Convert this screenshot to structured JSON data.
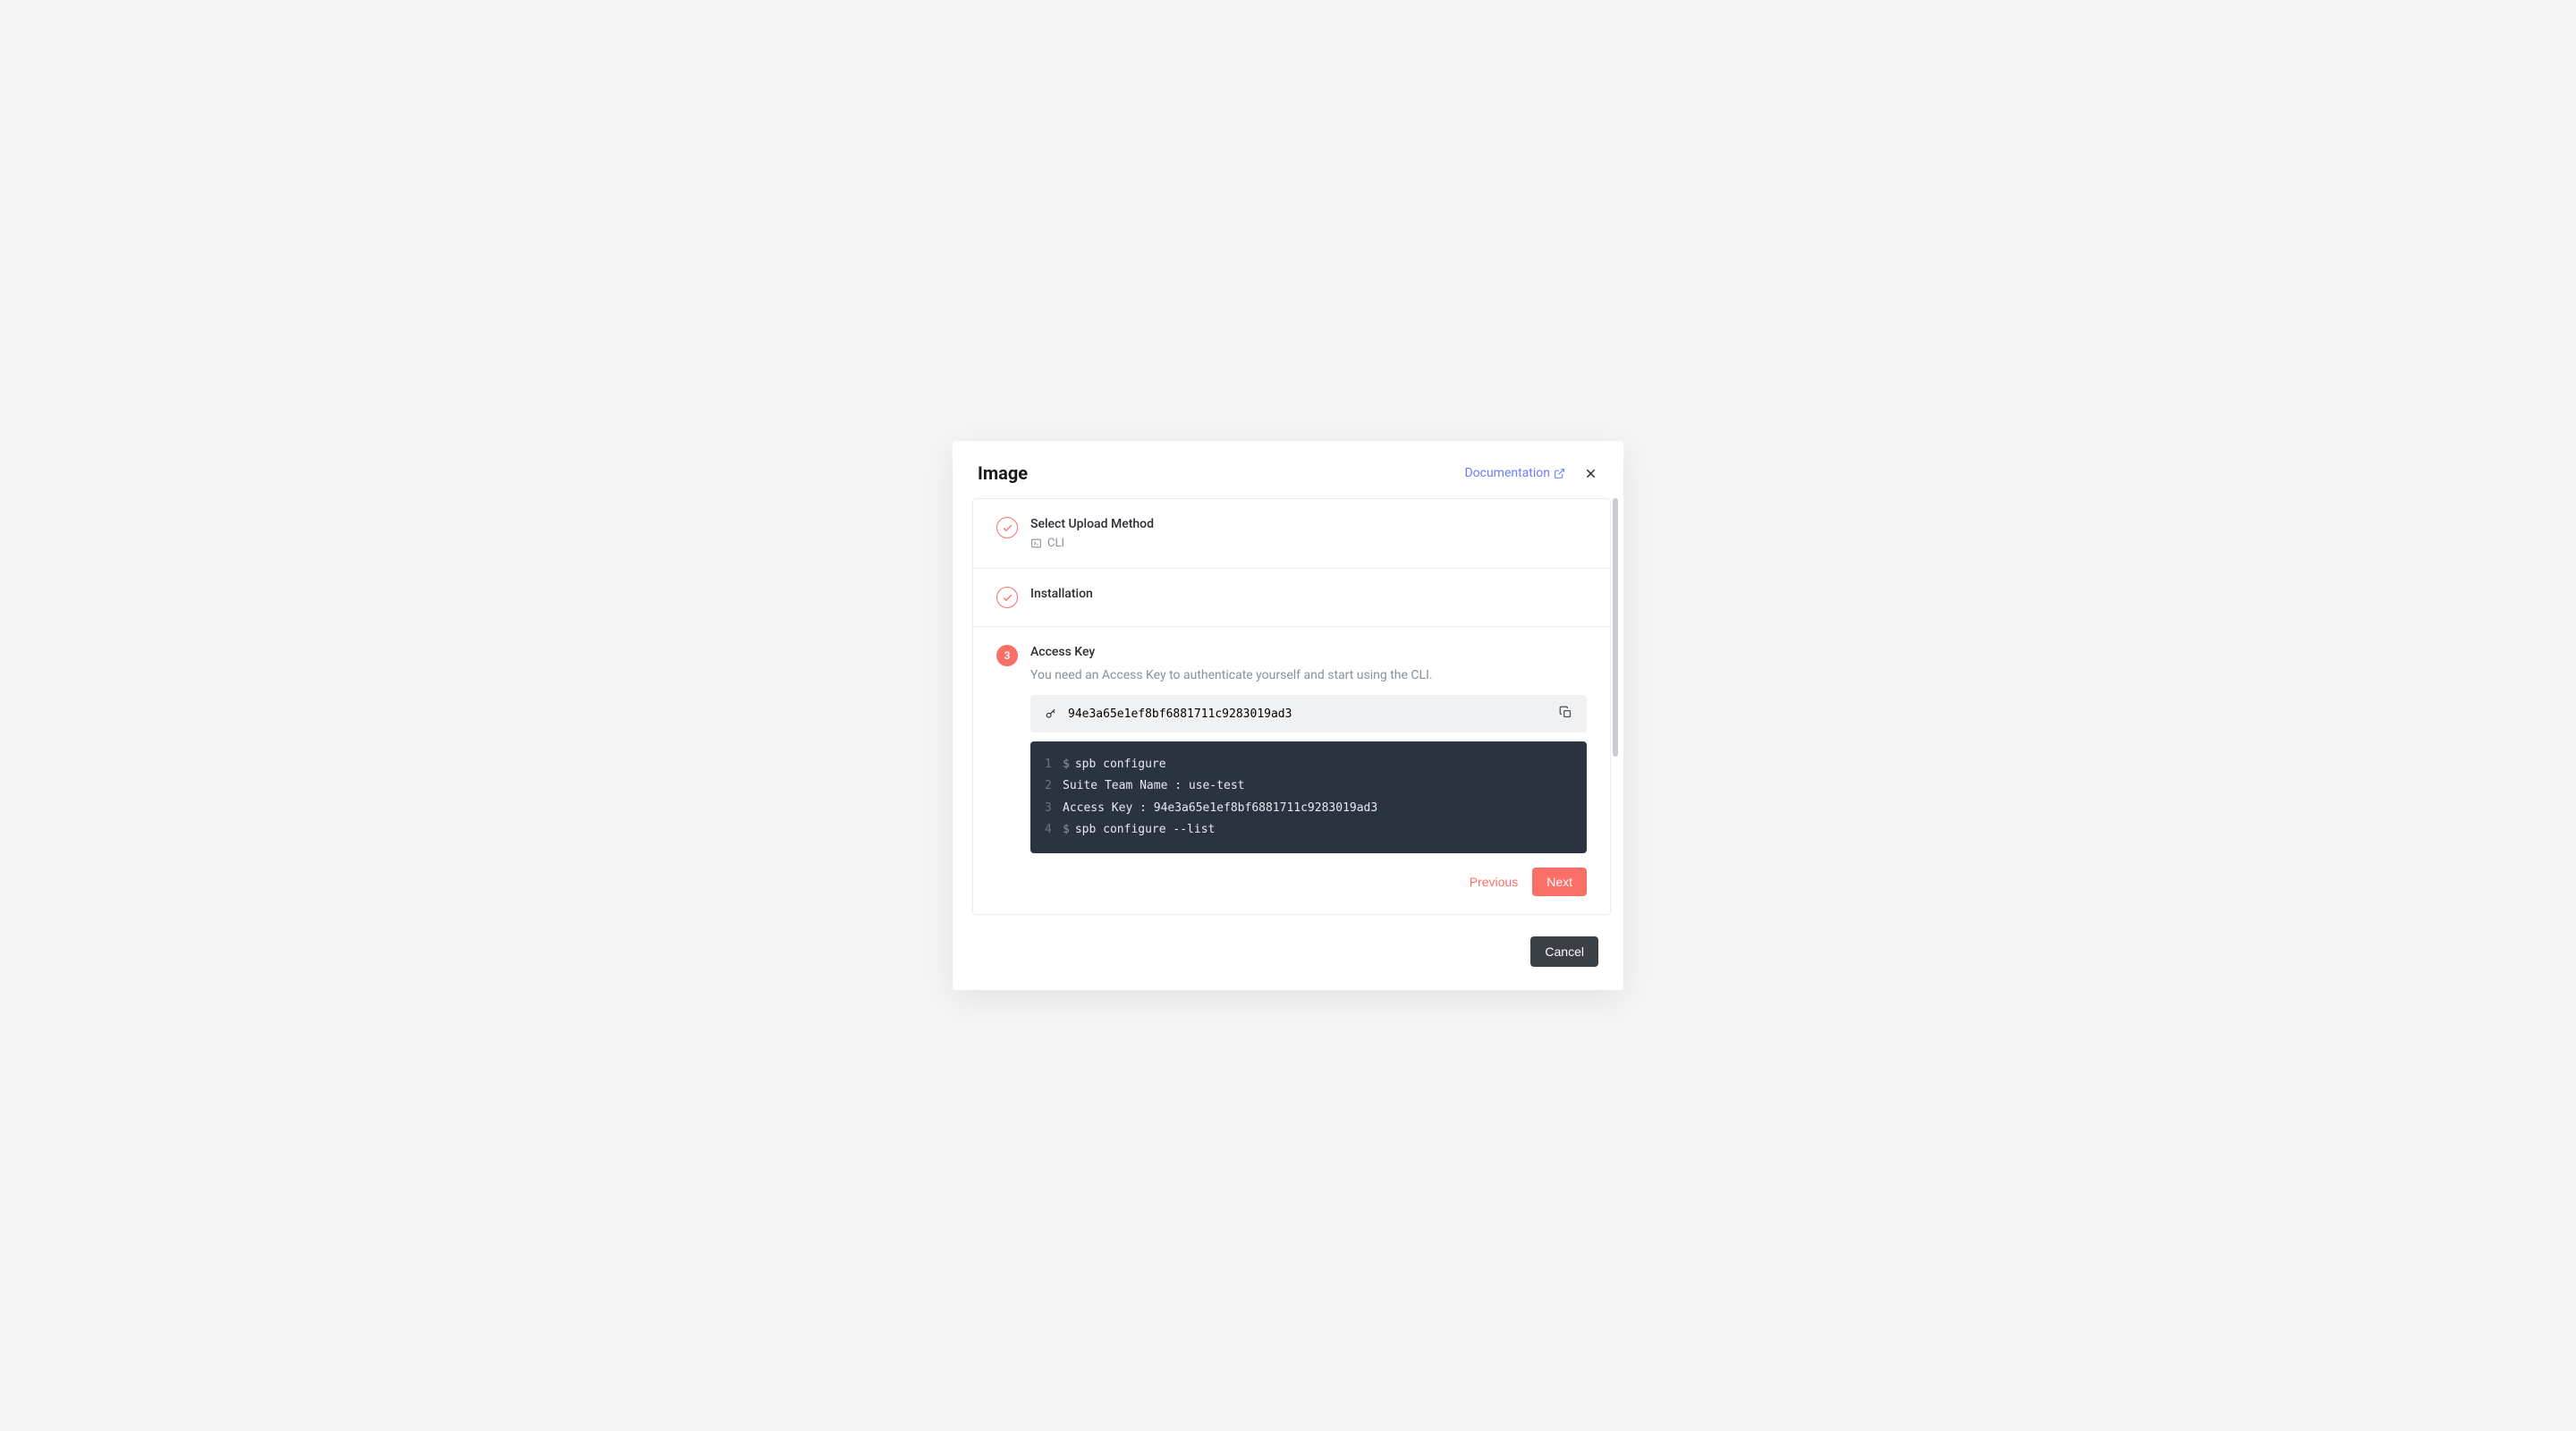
{
  "modal": {
    "title": "Image",
    "documentation_link": "Documentation",
    "steps": [
      {
        "title": "Select Upload Method",
        "subtitle": "CLI",
        "status": "done"
      },
      {
        "title": "Installation",
        "status": "done"
      },
      {
        "title": "Access Key",
        "status": "active",
        "number": "3",
        "description": "You need an Access Key to authenticate yourself and start using the CLI.",
        "access_key": "94e3a65e1ef8bf6881711c9283019ad3",
        "code": [
          {
            "n": "1",
            "prompt": "$",
            "text": "spb configure"
          },
          {
            "n": "2",
            "prompt": "",
            "text": "Suite Team Name : use-test"
          },
          {
            "n": "3",
            "prompt": "",
            "text": "Access Key : 94e3a65e1ef8bf6881711c9283019ad3"
          },
          {
            "n": "4",
            "prompt": "$",
            "text": "spb configure --list"
          }
        ]
      }
    ],
    "actions": {
      "previous": "Previous",
      "next": "Next",
      "cancel": "Cancel"
    }
  }
}
